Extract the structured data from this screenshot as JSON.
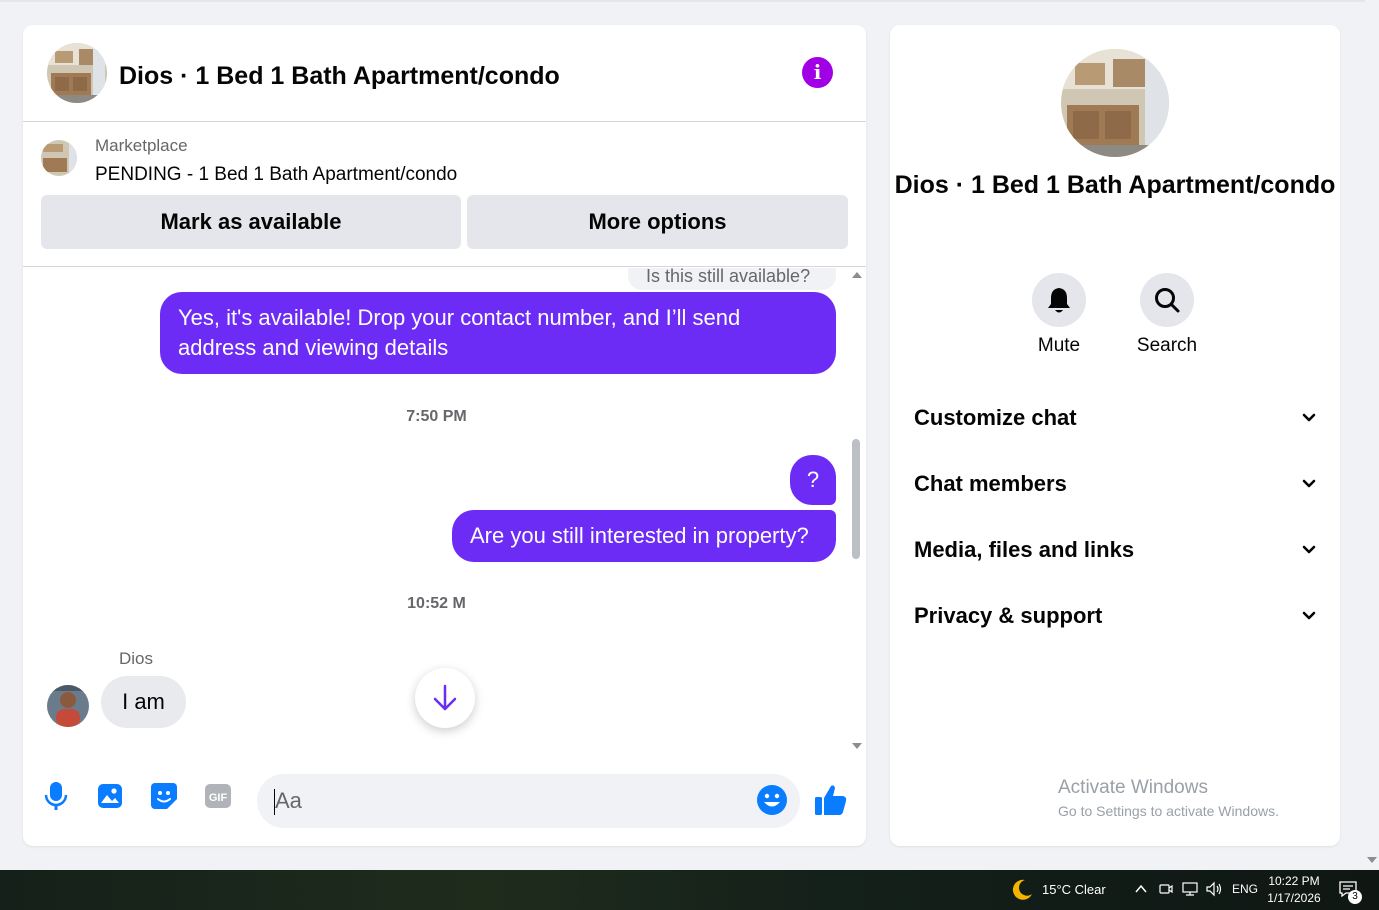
{
  "chat": {
    "title": "Dios · 1 Bed 1 Bath Apartment/condo",
    "marketplace": {
      "label": "Marketplace",
      "status": "PENDING - 1 Bed 1 Bath Apartment/condo",
      "mark_available_label": "Mark as available",
      "more_options_label": "More options"
    },
    "messages": {
      "quoted": "Is this still available?",
      "out1": "Yes, it's available! Drop your contact number, and I’ll send address and viewing details",
      "time1": "7:50 PM",
      "out2": "?",
      "out3": "Are you still interested in property?",
      "time2": "10:52 M",
      "sender": "Dios",
      "in1": "I  am"
    },
    "composer": {
      "placeholder": "Aa",
      "icons": [
        "microphone-icon",
        "photo-icon",
        "sticker-icon",
        "gif-icon",
        "emoji-icon",
        "thumbs-up-icon"
      ]
    }
  },
  "info": {
    "title": "Dios · 1 Bed 1 Bath Apartment/condo",
    "mute_label": "Mute",
    "search_label": "Search",
    "sections": [
      "Customize chat",
      "Chat members",
      "Media, files and links",
      "Privacy & support"
    ]
  },
  "watermark": {
    "line1": "Activate Windows",
    "line2": "Go to Settings to activate Windows."
  },
  "taskbar": {
    "weather": "15°C  Clear",
    "language": "ENG",
    "time": "10:22 PM",
    "date": "1/17/2026",
    "notification_count": "3"
  },
  "colors": {
    "accent_purple": "#6c2cf6",
    "info_purple": "#a100e6",
    "icon_blue": "#0a7cff"
  }
}
